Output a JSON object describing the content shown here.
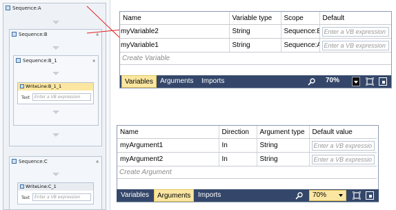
{
  "designer": {
    "sequence_a": "Sequence:A",
    "sequence_b": "Sequence:B",
    "sequence_b1": "Sequence:B_1",
    "writeline_b11": "WriteLine:B_1_1",
    "text_label": "Text",
    "text_placeholder": "Enter a VB expression",
    "sequence_c": "Sequence:C",
    "writeline_c1": "WriteLine:C_1",
    "collapse_glyph": "»"
  },
  "variables_panel": {
    "columns": [
      "Name",
      "Variable type",
      "Scope",
      "Default"
    ],
    "rows": [
      {
        "name": "myVariable2",
        "type": "String",
        "scope": "Sequence:B",
        "default_placeholder": "Enter a VB expression"
      },
      {
        "name": "myVariable1",
        "type": "String",
        "scope": "Sequence:A",
        "default_placeholder": "Enter a VB expression"
      }
    ],
    "create_label": "Create Variable",
    "tabs": [
      "Variables",
      "Arguments",
      "Imports"
    ],
    "active_tab": "Variables",
    "zoom": "70%"
  },
  "arguments_panel": {
    "columns": [
      "Name",
      "Direction",
      "Argument type",
      "Default value"
    ],
    "rows": [
      {
        "name": "myArgument1",
        "direction": "In",
        "type": "String",
        "default_placeholder": "Enter a VB expressio"
      },
      {
        "name": "myArgument2",
        "direction": "In",
        "type": "String",
        "default_placeholder": "Enter a VB expressio"
      }
    ],
    "create_label": "Create Argument",
    "tabs": [
      "Variables",
      "Arguments",
      "Imports"
    ],
    "active_tab": "Arguments",
    "zoom": "70%"
  },
  "colors": {
    "toolbar_bg": "#34476a",
    "active_tab_bg": "#fbe7a1",
    "annotation_line": "#e02020",
    "activity_header_bg": "#fbe7a1"
  }
}
